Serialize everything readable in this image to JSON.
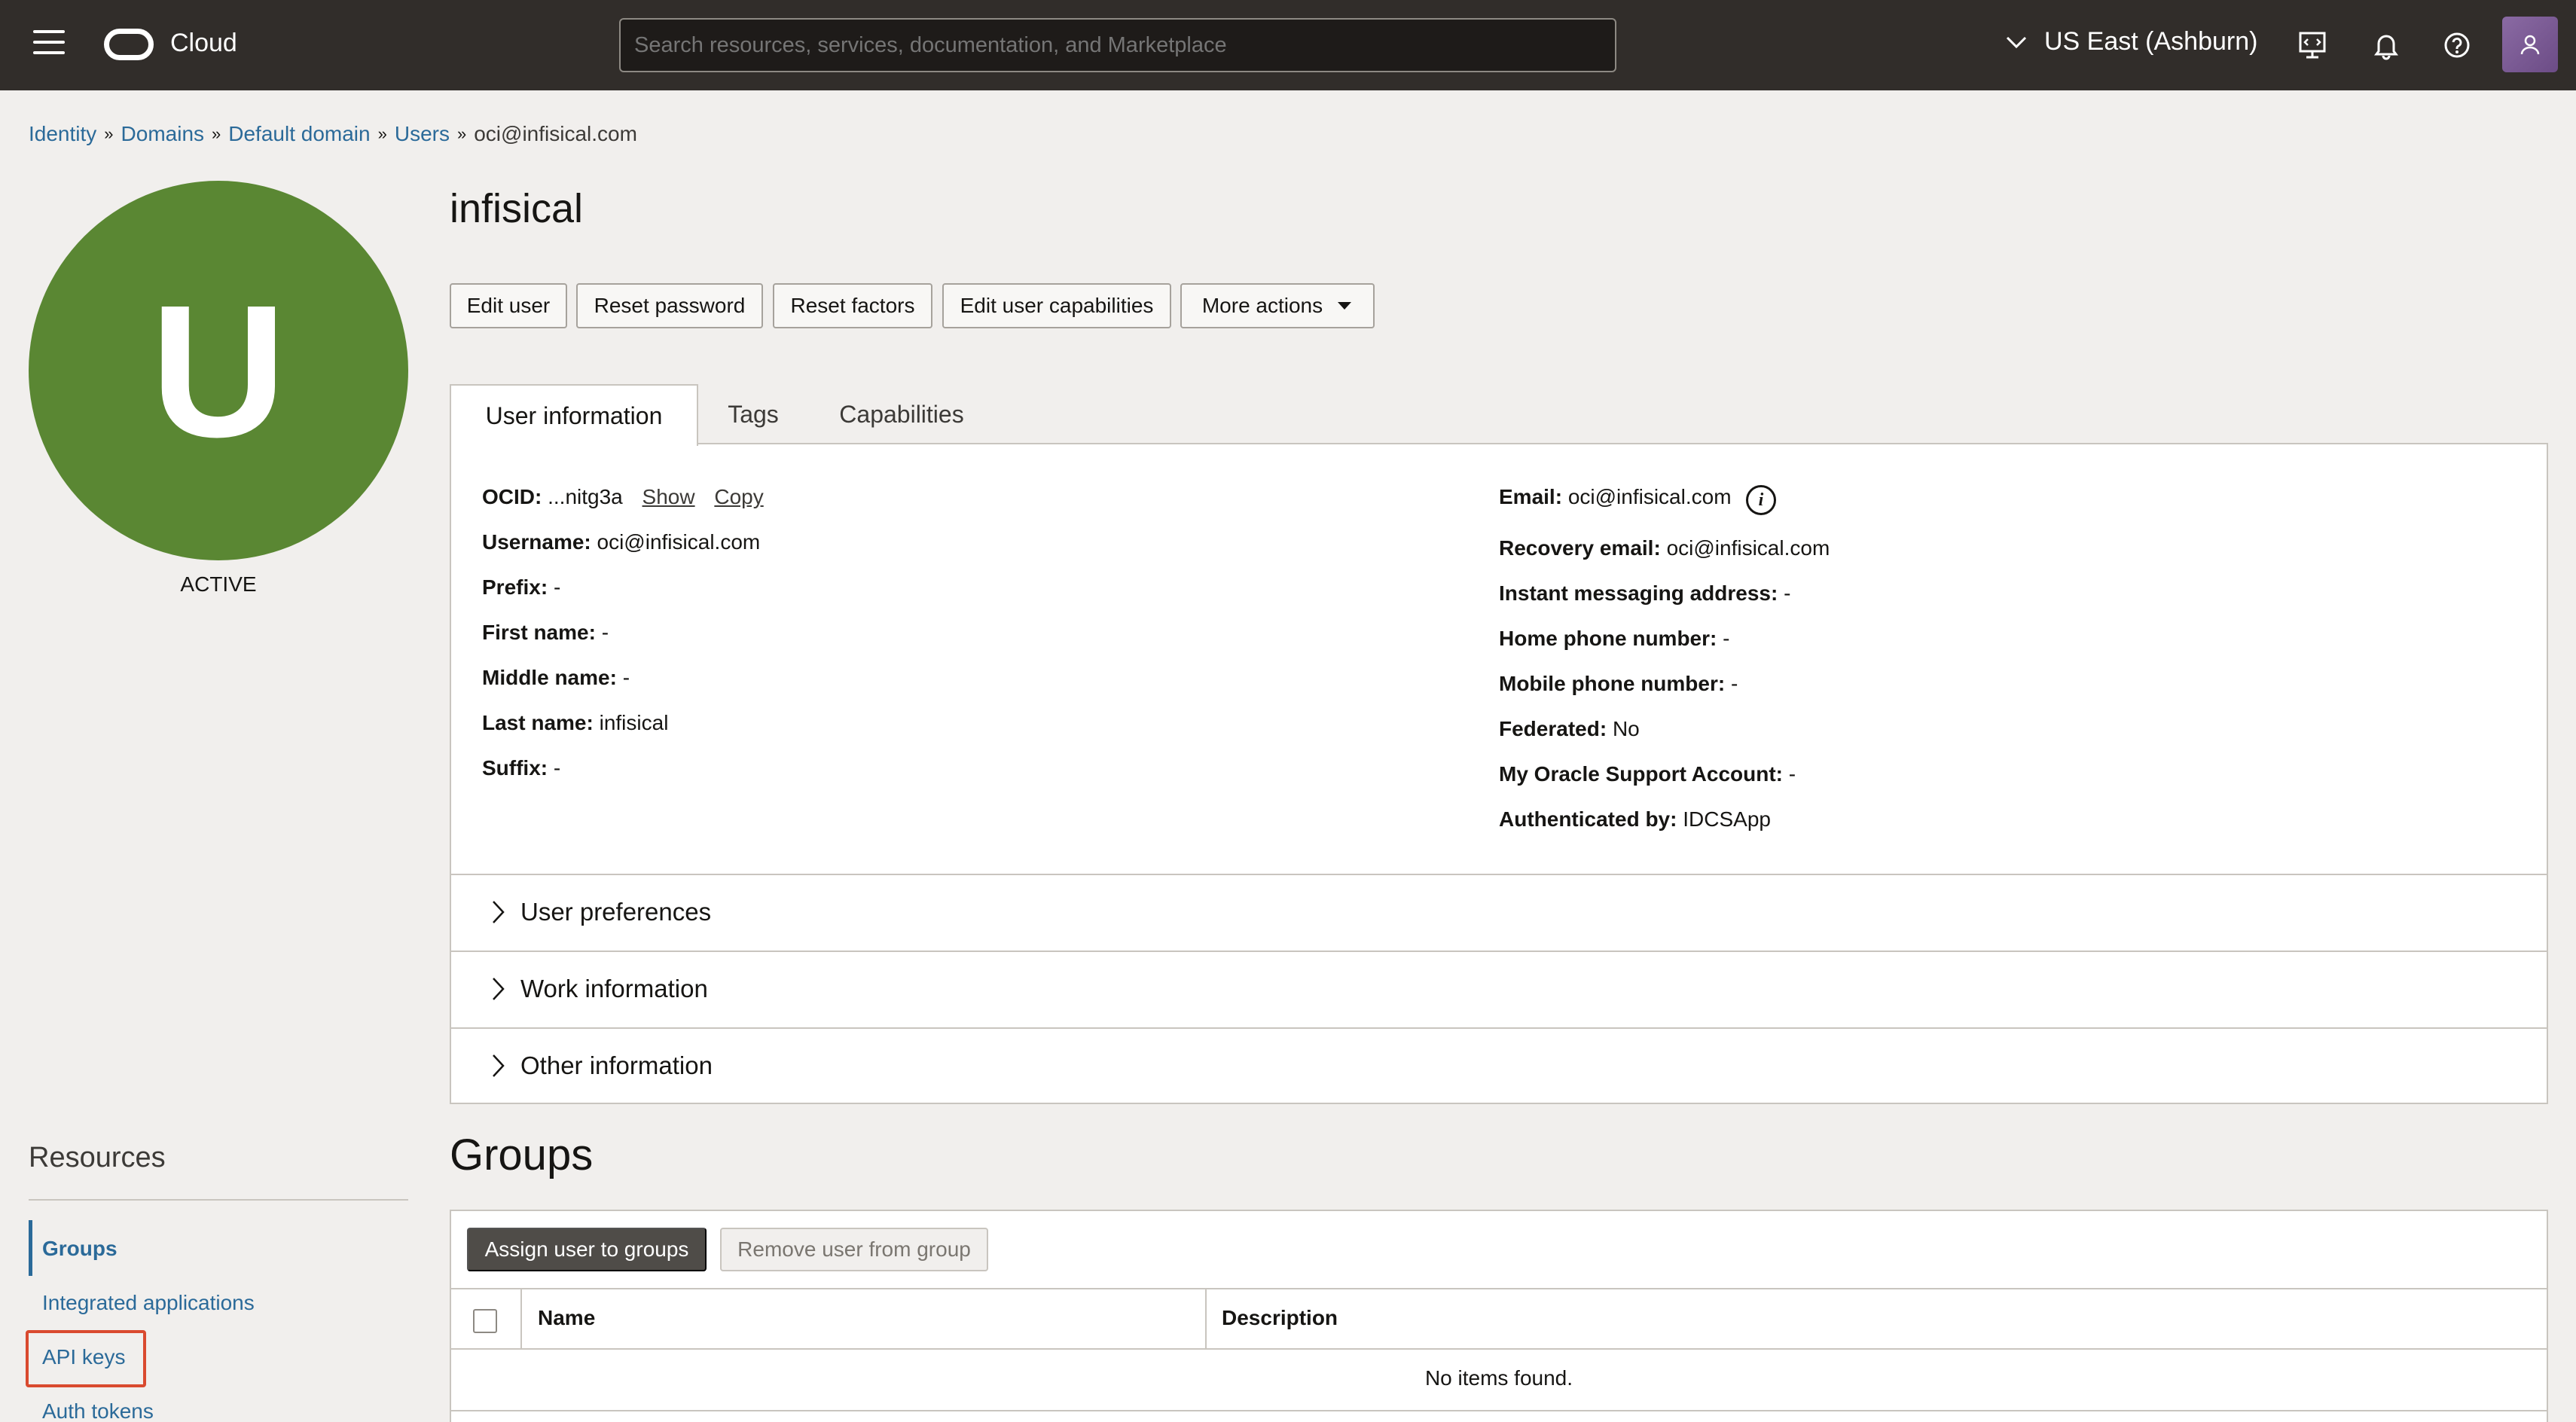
{
  "header": {
    "app_name": "Cloud",
    "search_placeholder": "Search resources, services, documentation, and Marketplace",
    "region": "US East (Ashburn)",
    "icons": [
      "menu-icon",
      "oracle-logo",
      "chevron-down-icon",
      "developer-tools-icon",
      "bell-icon",
      "help-icon",
      "profile-icon"
    ]
  },
  "breadcrumb": {
    "items": [
      "Identity",
      "Domains",
      "Default domain",
      "Users"
    ],
    "current": "oci@infisical.com"
  },
  "user": {
    "avatar_letter": "U",
    "avatar_color": "#5a8733",
    "status": "ACTIVE",
    "name": "infisical"
  },
  "actions": [
    "Edit user",
    "Reset password",
    "Reset factors",
    "Edit user capabilities",
    "More actions"
  ],
  "tabs": [
    "User information",
    "Tags",
    "Capabilities"
  ],
  "user_info": {
    "left": [
      {
        "label": "OCID:",
        "value": "...nitg3a"
      },
      {
        "label": "Username:",
        "value": "oci@infisical.com"
      },
      {
        "label": "Prefix:",
        "value": "-"
      },
      {
        "label": "First name:",
        "value": "-"
      },
      {
        "label": "Middle name:",
        "value": "-"
      },
      {
        "label": "Last name:",
        "value": "infisical"
      },
      {
        "label": "Suffix:",
        "value": "-"
      }
    ],
    "ocid_links": [
      "Show",
      "Copy"
    ],
    "right": [
      {
        "label": "Email:",
        "value": "oci@infisical.com"
      },
      {
        "label": "Recovery email:",
        "value": "oci@infisical.com"
      },
      {
        "label": "Instant messaging address:",
        "value": "-"
      },
      {
        "label": "Home phone number:",
        "value": "-"
      },
      {
        "label": "Mobile phone number:",
        "value": "-"
      },
      {
        "label": "Federated:",
        "value": "No"
      },
      {
        "label": "My Oracle Support Account:",
        "value": "-"
      },
      {
        "label": "Authenticated by:",
        "value": "IDCSApp"
      }
    ]
  },
  "sections": [
    "User preferences",
    "Work information",
    "Other information"
  ],
  "resources": {
    "title": "Resources",
    "items": [
      "Groups",
      "Integrated applications",
      "API keys",
      "Auth tokens"
    ],
    "active": "Groups",
    "highlighted": "API keys"
  },
  "groups": {
    "title": "Groups",
    "assign_label": "Assign user to groups",
    "remove_label": "Remove user from group",
    "columns": [
      "Name",
      "Description"
    ],
    "empty_text": "No items found."
  }
}
